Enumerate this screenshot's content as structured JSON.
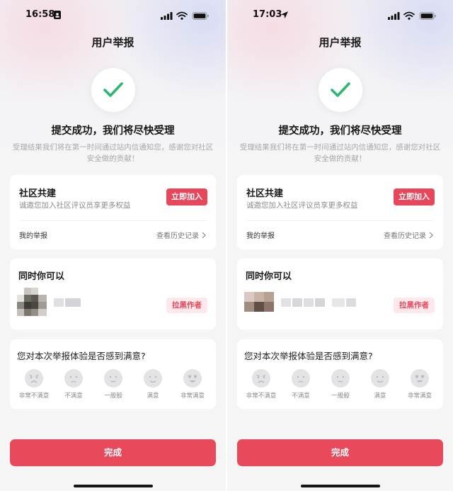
{
  "colors": {
    "accent": "#e8465a",
    "check": "#2bb673",
    "block_bg": "#fde9ec"
  },
  "screens": [
    {
      "status_bar": {
        "time": "16:58",
        "extra_icon": "id-card-icon"
      },
      "nav_title": "用户举报",
      "success_title": "提交成功，我们将尽快受理",
      "success_sub": "受理结果我们将在第一时间通过站内信通知您，感谢您对社区安全做的贡献！",
      "community": {
        "title": "社区共建",
        "desc": "诚邀您加入社区评议员享更多权益",
        "join_label": "立即加入",
        "my_report": "我的举报",
        "history": "查看历史记录"
      },
      "also": {
        "title": "同时你可以",
        "block_label": "拉黑作者"
      },
      "survey": {
        "question": "您对本次举报体验是否感到满意?",
        "options": [
          "非常不满意",
          "不满意",
          "一般般",
          "满意",
          "非常满意"
        ]
      },
      "done_label": "完成"
    },
    {
      "status_bar": {
        "time": "17:03",
        "extra_icon": "location-arrow-icon"
      },
      "nav_title": "用户举报",
      "success_title": "提交成功，我们将尽快受理",
      "success_sub": "受理结果我们将在第一时间通过站内信通知您，感谢您对社区安全做的贡献！",
      "community": {
        "title": "社区共建",
        "desc": "诚邀您加入社区评议员享更多权益",
        "join_label": "立即加入",
        "my_report": "我的举报",
        "history": "查看历史记录"
      },
      "also": {
        "title": "同时你可以",
        "block_label": "拉黑作者"
      },
      "survey": {
        "question": "您对本次举报体验是否感到满意?",
        "options": [
          "非常不满意",
          "不满意",
          "一般般",
          "满意",
          "非常满意"
        ]
      },
      "done_label": "完成"
    }
  ]
}
